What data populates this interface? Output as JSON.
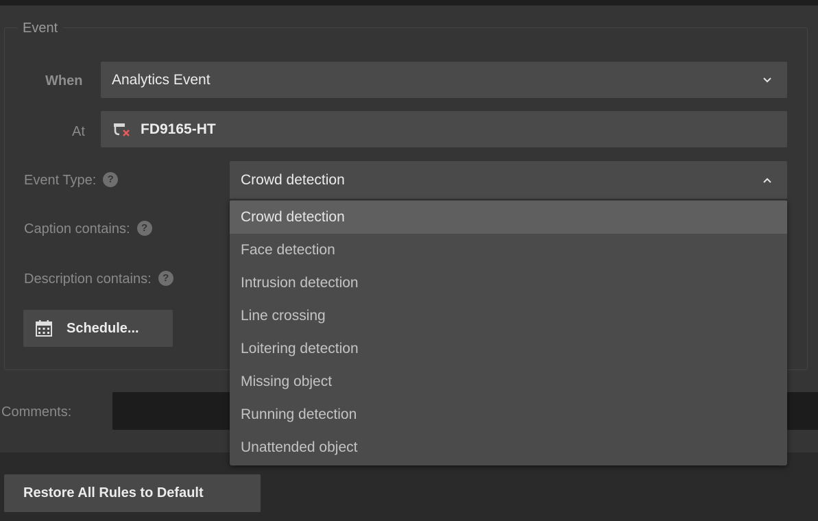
{
  "event": {
    "legend": "Event",
    "when_label": "When",
    "when_value": "Analytics Event",
    "at_label": "At",
    "at_value": "FD9165-HT",
    "event_type_label": "Event Type:",
    "event_type_value": "Crowd detection",
    "caption_label": "Caption contains:",
    "description_label": "Description contains:",
    "schedule_button": "Schedule...",
    "help_glyph": "?"
  },
  "comments_label": "Comments:",
  "event_type_options": [
    "Crowd detection",
    "Face detection",
    "Intrusion detection",
    "Line crossing",
    "Loitering detection",
    "Missing object",
    "Running detection",
    "Unattended object"
  ],
  "restore_button": "Restore All Rules to Default",
  "icons": {
    "camera": "camera-offline-icon",
    "calendar": "calendar-icon",
    "chevron_down": "chevron-down-icon",
    "chevron_up": "chevron-up-icon",
    "help": "help-icon"
  }
}
